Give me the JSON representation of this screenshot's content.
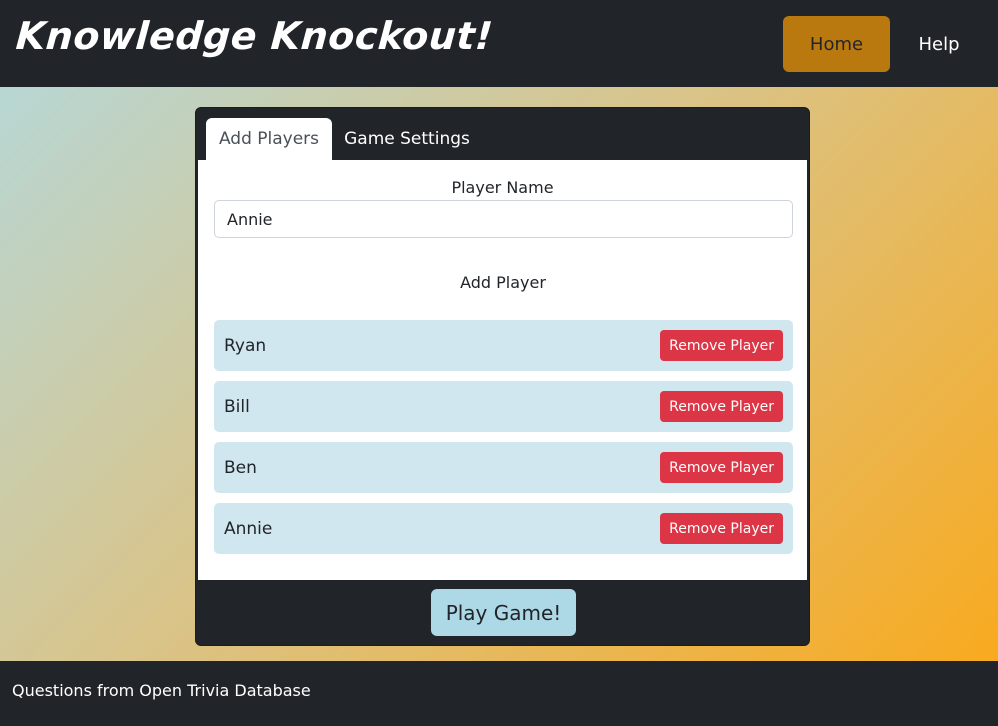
{
  "header": {
    "brand": "Knowledge Knockout!",
    "nav": {
      "home": "Home",
      "help": "Help"
    }
  },
  "tabs": [
    {
      "label": "Add Players",
      "active": true
    },
    {
      "label": "Game Settings",
      "active": false
    }
  ],
  "form": {
    "player_name_label": "Player Name",
    "player_name_value": "Annie",
    "add_player_label": "Add Player"
  },
  "players": [
    {
      "name": "Ryan",
      "remove_label": "Remove Player"
    },
    {
      "name": "Bill",
      "remove_label": "Remove Player"
    },
    {
      "name": "Ben",
      "remove_label": "Remove Player"
    },
    {
      "name": "Annie",
      "remove_label": "Remove Player"
    }
  ],
  "play_button": "Play Game!",
  "footer": {
    "text": "Questions from Open Trivia Database"
  },
  "colors": {
    "dark": "#212529",
    "home_button": "#b9790f",
    "remove_button": "#dc3545",
    "player_row": "#d1e7ef",
    "play_button": "#add8e6",
    "gradient_start": "#b3d9dd",
    "gradient_end": "#fba817"
  }
}
